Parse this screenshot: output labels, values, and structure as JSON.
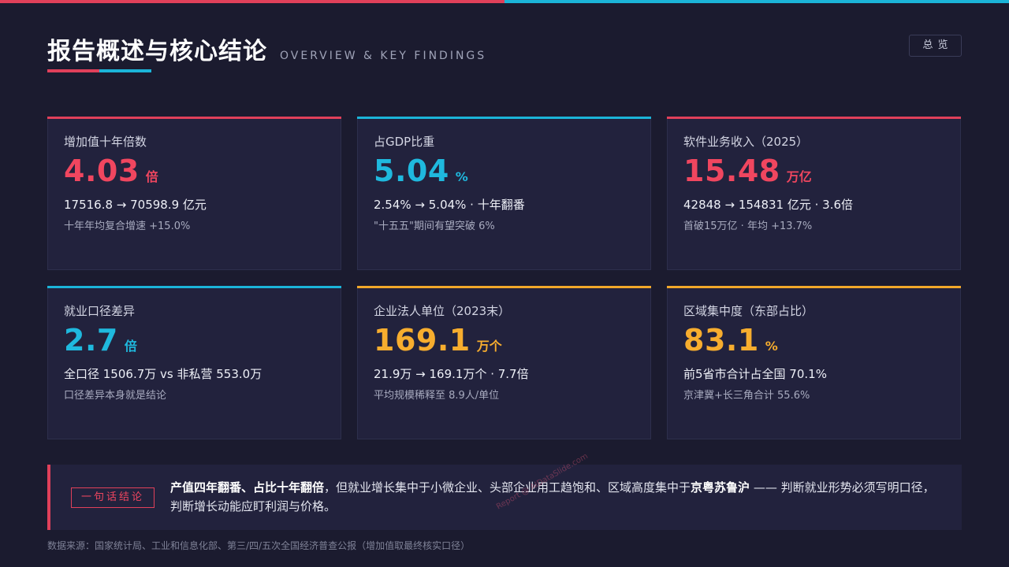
{
  "header": {
    "title": "报告概述与核心结论",
    "subtitle": "OVERVIEW & KEY FINDINGS",
    "overview_button": "总览"
  },
  "colors": {
    "red": "#e0405a",
    "cyan": "#1bb4d8",
    "amber": "#f2a82a",
    "background": "#1b1b2f",
    "card": "#22223d"
  },
  "cards": [
    {
      "label": "增加值十年倍数",
      "value": "4.03",
      "unit": "倍",
      "detail": "17516.8 → 70598.9 亿元",
      "note": "十年年均复合增速 +15.0%"
    },
    {
      "label": "占GDP比重",
      "value": "5.04",
      "unit": "%",
      "detail": "2.54% → 5.04% · 十年翻番",
      "note": "\"十五五\"期间有望突破 6%"
    },
    {
      "label": "软件业务收入（2025）",
      "value": "15.48",
      "unit": "万亿",
      "detail": "42848 → 154831 亿元 · 3.6倍",
      "note": "首破15万亿 · 年均 +13.7%"
    },
    {
      "label": "就业口径差异",
      "value": "2.7",
      "unit": "倍",
      "detail": "全口径 1506.7万 vs 非私营 553.0万",
      "note": "口径差异本身就是结论"
    },
    {
      "label": "企业法人单位（2023末）",
      "value": "169.1",
      "unit": "万个",
      "detail": "21.9万 → 169.1万个 · 7.7倍",
      "note": "平均规模稀释至 8.9人/单位"
    },
    {
      "label": "区域集中度（东部占比）",
      "value": "83.1",
      "unit": "%",
      "detail": "前5省市合计占全国 70.1%",
      "note": "京津冀+长三角合计 55.6%"
    }
  ],
  "conclusion": {
    "tag": "一句话结论",
    "bold_1": "产值四年翻番、占比十年翻倍",
    "text_1": "，但就业增长集中于小微企业、头部企业用工趋饱和、区域高度集中于",
    "bold_2": "京粤苏鲁沪",
    "text_2": " —— 判断就业形势必须写明口径，判断增长动能应盯利润与价格。"
  },
  "watermark": "Report @ AIDataSlide.com",
  "source": "数据来源：国家统计局、工业和信息化部、第三/四/五次全国经济普查公报（增加值取最终核实口径）"
}
